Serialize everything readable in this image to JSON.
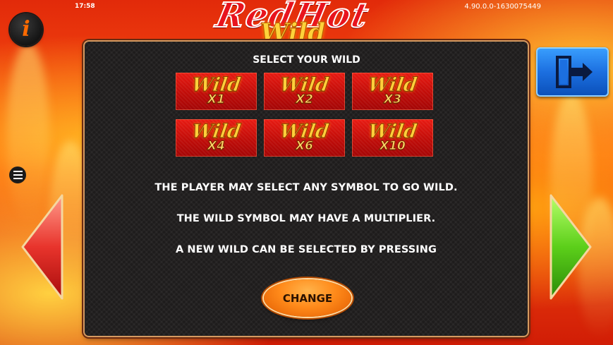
{
  "status_bar": {
    "clock": "17:58",
    "version": "4.90.0.0-1630075449"
  },
  "logo": {
    "line1": "RedHot",
    "line2": "Wild"
  },
  "info_button": {
    "glyph": "i",
    "icon": "info-icon"
  },
  "menu_button": {
    "icon": "hamburger-menu-icon"
  },
  "panel": {
    "title": "SELECT YOUR WILD",
    "wild_options": [
      {
        "label": "Wild",
        "multiplier": "X1"
      },
      {
        "label": "Wild",
        "multiplier": "X2"
      },
      {
        "label": "Wild",
        "multiplier": "X3"
      },
      {
        "label": "Wild",
        "multiplier": "X4"
      },
      {
        "label": "Wild",
        "multiplier": "X6"
      },
      {
        "label": "Wild",
        "multiplier": "X10"
      }
    ],
    "rules": [
      "THE PLAYER MAY SELECT ANY SYMBOL TO GO WILD.",
      "THE WILD SYMBOL MAY HAVE A MULTIPLIER.",
      "A NEW WILD CAN BE SELECTED BY PRESSING"
    ],
    "change_button": "CHANGE"
  },
  "exit_button": {
    "icon": "exit-door-arrow-icon",
    "color": "#1c6fe0"
  },
  "nav": {
    "prev_icon": "left-arrow-icon",
    "prev_color": "#e8342c",
    "next_icon": "right-arrow-icon",
    "next_color": "#5ccf1a"
  }
}
